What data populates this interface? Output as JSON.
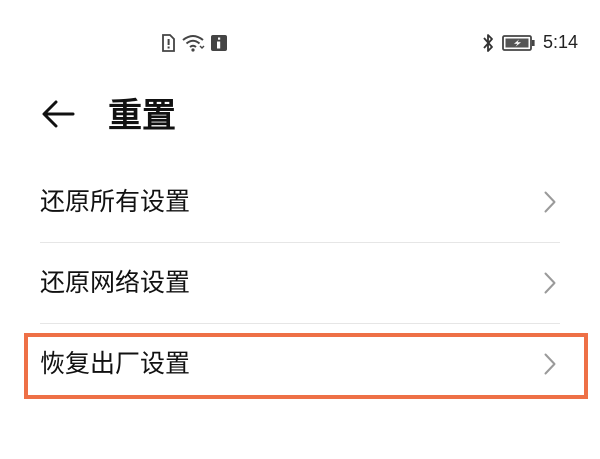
{
  "status_bar": {
    "time": "5:14",
    "icons_left": [
      "sim-alert-icon",
      "wifi-icon",
      "info-icon"
    ],
    "icons_right": [
      "bluetooth-icon",
      "battery-charging-icon"
    ]
  },
  "header": {
    "title": "重置",
    "back_icon": "arrow-left-icon"
  },
  "settings": {
    "items": [
      {
        "label": "还原所有设置"
      },
      {
        "label": "还原网络设置"
      },
      {
        "label": "恢复出厂设置",
        "highlighted": true
      }
    ]
  },
  "colors": {
    "highlight": "#ee7046",
    "divider": "#e6e6e6",
    "chevron": "#9a9a9a"
  }
}
